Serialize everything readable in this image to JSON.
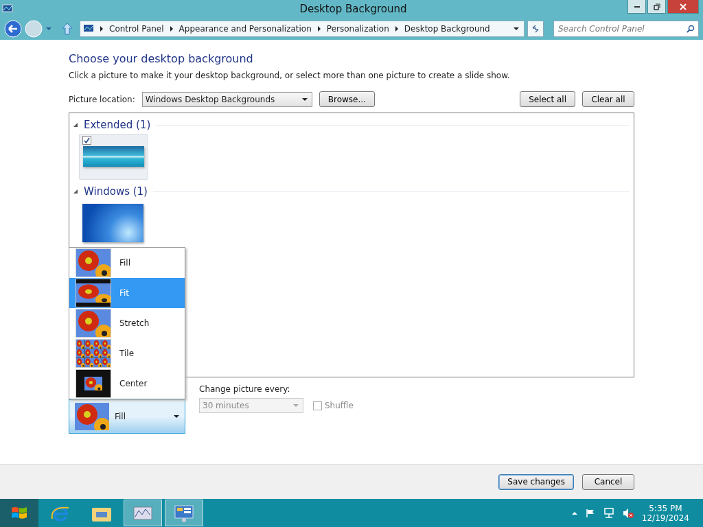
{
  "window": {
    "title": "Desktop Background"
  },
  "address_bar": {
    "breadcrumbs": [
      "Control Panel",
      "Appearance and Personalization",
      "Personalization",
      "Desktop Background"
    ]
  },
  "search": {
    "placeholder": "Search Control Panel"
  },
  "heading": "Choose your desktop background",
  "description": "Click a picture to make it your desktop background, or select more than one picture to create a slide show.",
  "picture_location": {
    "label": "Picture location:",
    "value": "Windows Desktop Backgrounds",
    "browse": "Browse..."
  },
  "buttons_top": [
    "Select all",
    "Clear all"
  ],
  "groups": [
    {
      "name": "Extended (1)",
      "expanded": true,
      "pictures": [
        {
          "kind": "panorama",
          "checked": true
        }
      ]
    },
    {
      "name": "Windows (1)",
      "expanded": true,
      "pictures": [
        {
          "kind": "windows",
          "checked": false
        }
      ]
    }
  ],
  "picture_position": {
    "value": "Fill",
    "kind": "fill",
    "expanded": true,
    "options": [
      {
        "label": "Fill",
        "kind": "fill",
        "highlighted": false
      },
      {
        "label": "Fit",
        "kind": "fit",
        "highlighted": true
      },
      {
        "label": "Stretch",
        "kind": "stretch",
        "highlighted": false
      },
      {
        "label": "Tile",
        "kind": "tile",
        "highlighted": false
      },
      {
        "label": "Center",
        "kind": "center",
        "highlighted": false
      }
    ]
  },
  "change_picture": {
    "label": "Change picture every:",
    "value": "30 minutes",
    "disabled": true
  },
  "shuffle": {
    "label": "Shuffle",
    "checked": false,
    "disabled": true
  },
  "footer_buttons": [
    "Save changes",
    "Cancel"
  ],
  "taskbar": {
    "apps": [
      {
        "kind": "browser",
        "selected": false
      },
      {
        "kind": "folder",
        "selected": false
      },
      {
        "kind": "monitor",
        "selected": true
      },
      {
        "kind": "control-panel",
        "selected": true
      }
    ],
    "time": "5:35 PM",
    "date": "12/19/2024"
  }
}
